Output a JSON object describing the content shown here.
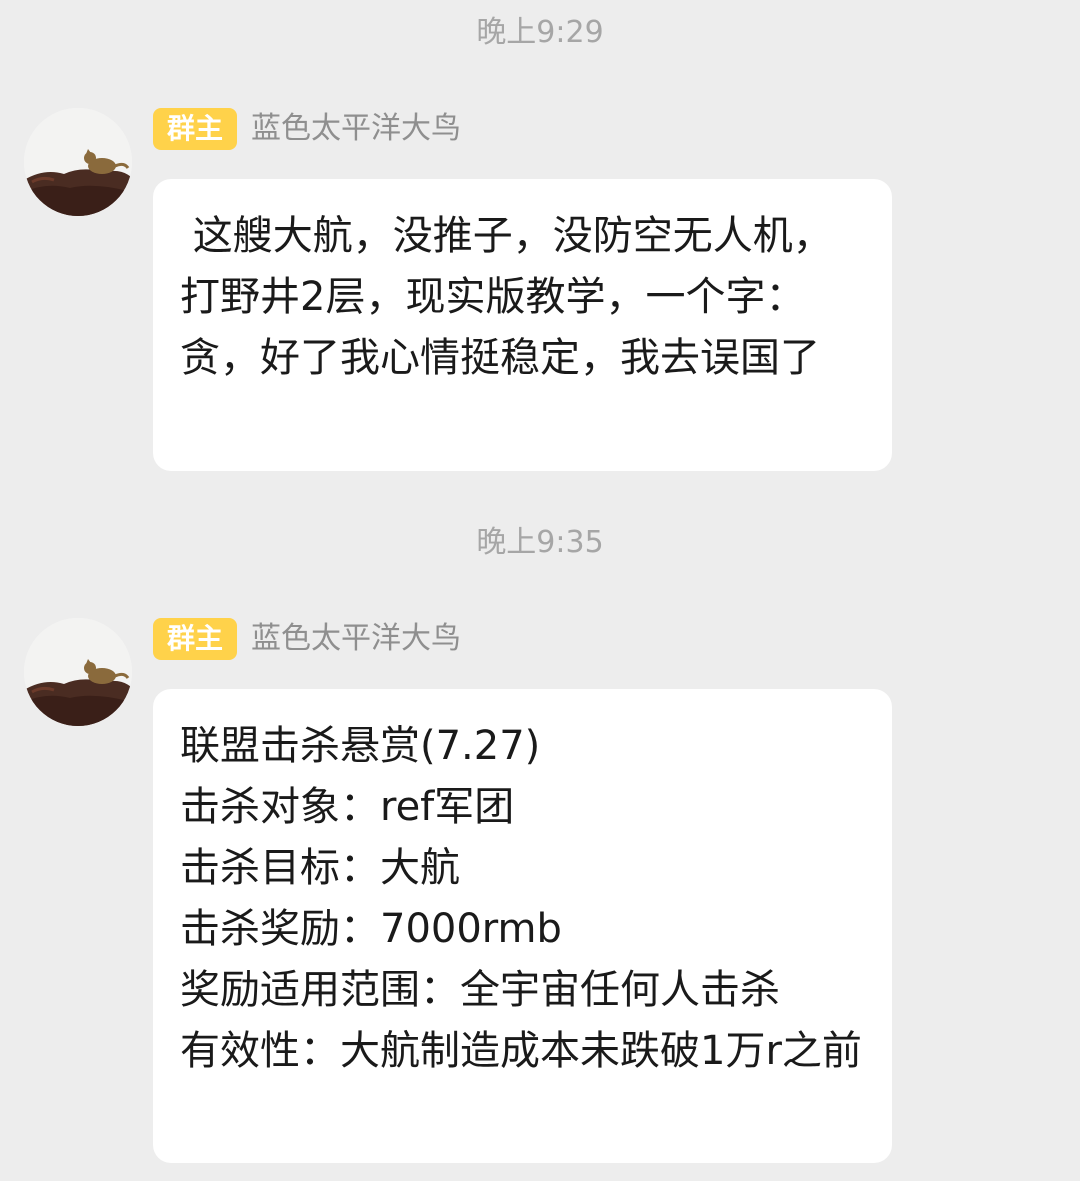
{
  "messages": [
    {
      "timestamp": "晚上9:29",
      "badge": "群主",
      "sender": "蓝色太平洋大鸟",
      "avatar_icon": "cat-on-rock-avatar",
      "text": " 这艘大航，没推子，没防空无人机，打野井2层，现实版教学，一个字：贪，好了我心情挺稳定，我去误国了"
    },
    {
      "timestamp": "晚上9:35",
      "badge": "群主",
      "sender": "蓝色太平洋大鸟",
      "avatar_icon": "cat-on-rock-avatar",
      "text": "联盟击杀悬赏(7.27)\n击杀对象：ref军团\n击杀目标：大航\n击杀奖励：7000rmb\n奖励适用范围：全宇宙任何人击杀\n有效性：大航制造成本未跌破1万r之前"
    }
  ],
  "colors": {
    "background": "#ededed",
    "bubble": "#ffffff",
    "badge": "#ffd24a",
    "timestamp": "#a6a6a6",
    "sender_name": "#8f8f8f"
  }
}
